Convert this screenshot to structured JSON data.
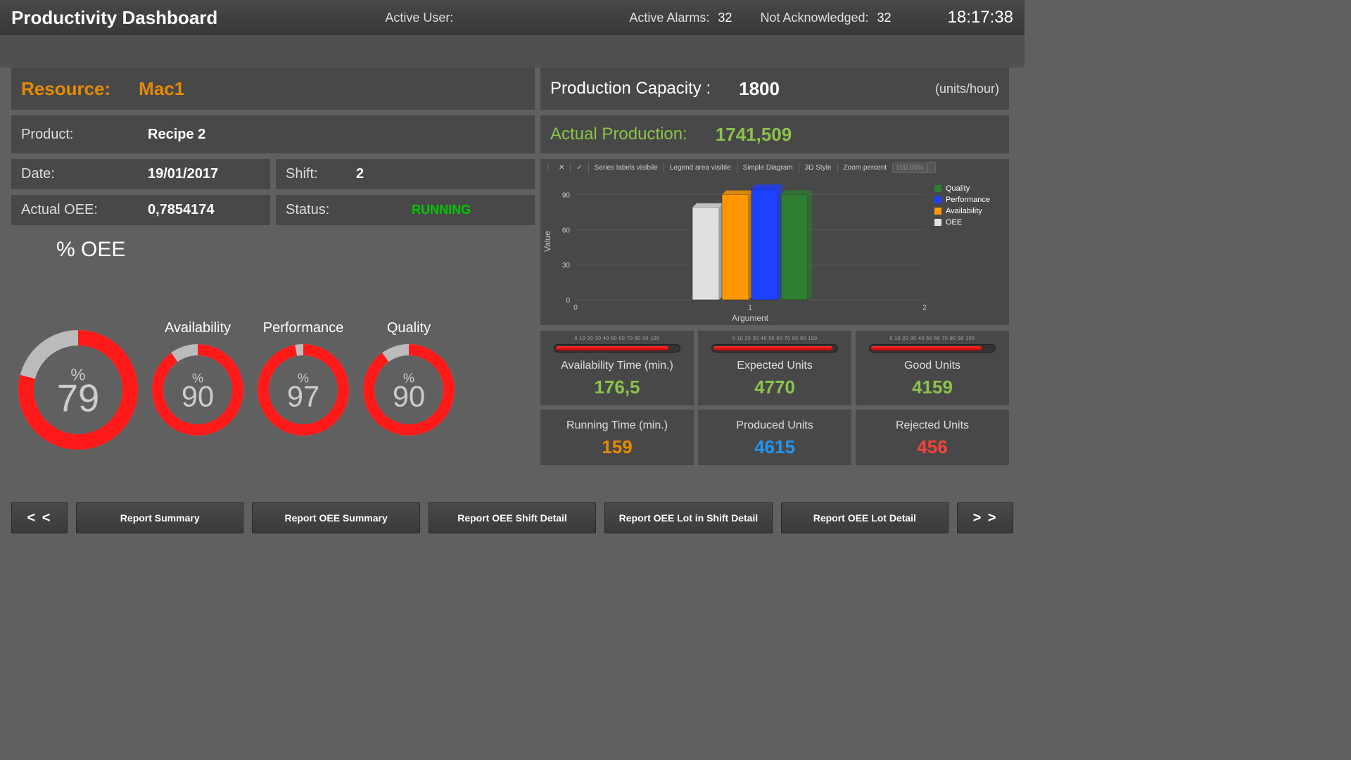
{
  "header": {
    "title": "Productivity Dashboard",
    "active_user_label": "Active User:",
    "active_user_value": "",
    "active_alarms_label": "Active Alarms:",
    "active_alarms_value": "32",
    "not_ack_label": "Not Acknowledged:",
    "not_ack_value": "32",
    "time": "18:17:38"
  },
  "left": {
    "resource_label": "Resource:",
    "resource_value": "Mac1",
    "product_label": "Product:",
    "product_value": "Recipe 2",
    "date_label": "Date:",
    "date_value": "19/01/2017",
    "shift_label": "Shift:",
    "shift_value": "2",
    "oee_label": "Actual OEE:",
    "oee_value": "0,7854174",
    "status_label": "Status:",
    "status_value": "RUNNING"
  },
  "oee": {
    "title": "% OEE",
    "main": {
      "pct_sign": "%",
      "value": "79",
      "pct": 79
    },
    "gauges": [
      {
        "label": "Availability",
        "value": "90",
        "pct": 90
      },
      {
        "label": "Performance",
        "value": "97",
        "pct": 97
      },
      {
        "label": "Quality",
        "value": "90",
        "pct": 90
      }
    ]
  },
  "right": {
    "capacity_label": "Production Capacity :",
    "capacity_value": "1800",
    "capacity_units": "(units/hour)",
    "actual_label": "Actual Production:",
    "actual_value": "1741,509"
  },
  "chart_toolbar": {
    "series_labels": "Series labels visibile",
    "legend_area": "Legend area visible",
    "simple": "Simple Diagram",
    "style3d": "3D Style",
    "zoom": "Zoom percent",
    "zoom_value": "100.00%"
  },
  "chart_data": {
    "type": "bar",
    "title": "",
    "xlabel": "Argument",
    "ylabel": "Value",
    "ylim": [
      0,
      100
    ],
    "yticks": [
      0,
      30,
      60,
      90
    ],
    "xticks": [
      0,
      1,
      2
    ],
    "categories": [
      "1"
    ],
    "series": [
      {
        "name": "OEE",
        "color": "#e0e0e0",
        "values": [
          79
        ]
      },
      {
        "name": "Availability",
        "color": "#ff9800",
        "values": [
          90
        ]
      },
      {
        "name": "Performance",
        "color": "#1e40ff",
        "values": [
          95
        ]
      },
      {
        "name": "Quality",
        "color": "#2e7d32",
        "values": [
          90
        ]
      }
    ],
    "legend": [
      "Quality",
      "Performance",
      "Availability",
      "OEE"
    ],
    "legend_colors": [
      "#2e7d32",
      "#1e40ff",
      "#ff9800",
      "#e0e0e0"
    ]
  },
  "metrics": [
    {
      "label": "Availability Time (min.)",
      "value": "176,5",
      "color": "v-green",
      "scale": true,
      "fill": 90
    },
    {
      "label": "Expected Units",
      "value": "4770",
      "color": "v-green",
      "scale": true,
      "fill": 95
    },
    {
      "label": "Good Units",
      "value": "4159",
      "color": "v-green",
      "scale": true,
      "fill": 88
    },
    {
      "label": "Running Time (min.)",
      "value": "159",
      "color": "v-orange",
      "scale": false
    },
    {
      "label": "Produced Units",
      "value": "4615",
      "color": "v-blue",
      "scale": false
    },
    {
      "label": "Rejected Units",
      "value": "456",
      "color": "v-red",
      "scale": false
    }
  ],
  "scale_text": "0  10  20  30  40  50  60  70  80  90 100",
  "footer": {
    "prev": "< <",
    "next": "> >",
    "buttons": [
      "Report Summary",
      "Report OEE Summary",
      "Report OEE Shift Detail",
      "Report OEE Lot in Shift Detail",
      "Report OEE Lot Detail"
    ]
  }
}
